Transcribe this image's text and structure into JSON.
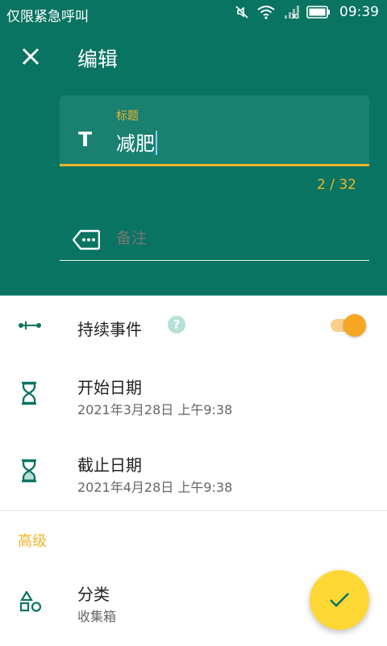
{
  "status_bar": {
    "carrier": "仅限紧急呼叫",
    "time": "09:39"
  },
  "header": {
    "title": "编辑"
  },
  "title_field": {
    "label": "标题",
    "value": "减肥",
    "counter": "2 / 32"
  },
  "note_field": {
    "placeholder": "备注"
  },
  "duration_event": {
    "label": "持续事件",
    "help": "?",
    "enabled": true
  },
  "start_date": {
    "label": "开始日期",
    "value": "2021年3月28日 上午9:38"
  },
  "end_date": {
    "label": "截止日期",
    "value": "2021年4月28日 上午9:38"
  },
  "advanced": {
    "section_label": "高级",
    "category": {
      "label": "分类",
      "value": "收集箱"
    }
  },
  "colors": {
    "primary": "#0a7462",
    "accent": "#f0b429",
    "toggle": "#f5a623",
    "fab": "#fdd835"
  },
  "icons": {
    "close": "close-icon",
    "title": "text-icon",
    "note": "tag-icon",
    "duration": "timeline-icon",
    "start": "hourglass-icon",
    "end": "hourglass-icon",
    "category": "shapes-icon",
    "fab": "check-icon"
  }
}
